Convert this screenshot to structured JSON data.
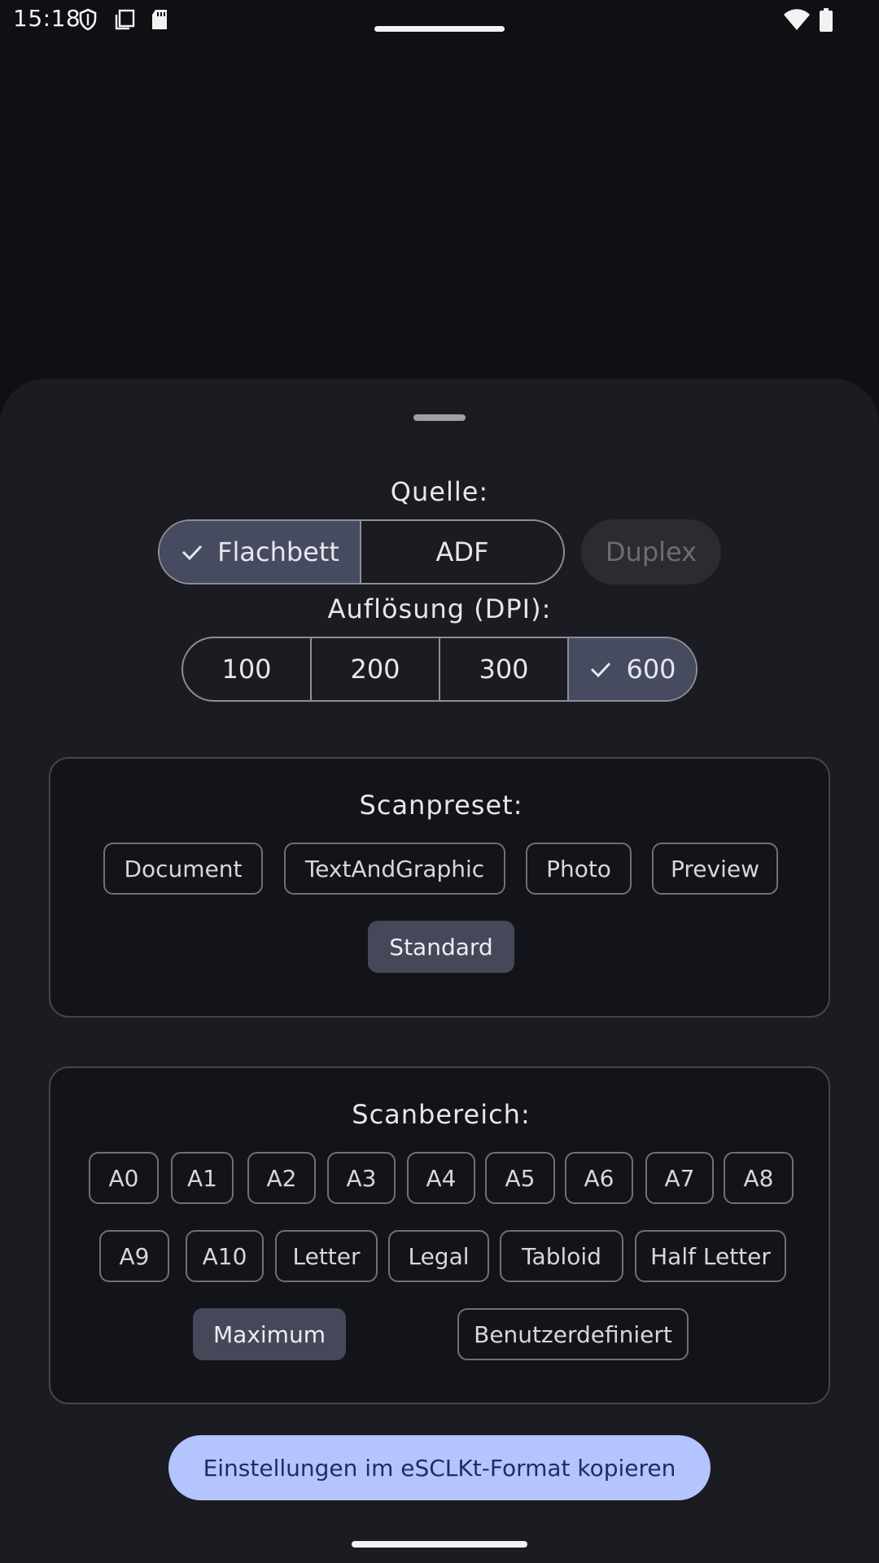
{
  "status_bar": {
    "time": "15:18"
  },
  "source": {
    "label": "Quelle:",
    "options": [
      {
        "label": "Flachbett",
        "selected": true
      },
      {
        "label": "ADF",
        "selected": false
      }
    ],
    "duplex_label": "Duplex"
  },
  "resolution": {
    "label": "Auflösung (DPI):",
    "options": [
      {
        "label": "100",
        "selected": false
      },
      {
        "label": "200",
        "selected": false
      },
      {
        "label": "300",
        "selected": false
      },
      {
        "label": "600",
        "selected": true
      }
    ]
  },
  "scanpreset": {
    "label": "Scanpreset:",
    "chips": [
      "Document",
      "TextAndGraphic",
      "Photo",
      "Preview",
      "Standard"
    ],
    "selected": "Standard"
  },
  "scanbereich": {
    "label": "Scanbereich:",
    "chips": [
      "A0",
      "A1",
      "A2",
      "A3",
      "A4",
      "A5",
      "A6",
      "A7",
      "A8",
      "A9",
      "A10",
      "Letter",
      "Legal",
      "Tabloid",
      "Half Letter",
      "Maximum",
      "Benutzerdefiniert"
    ],
    "selected": "Maximum"
  },
  "copy_button": {
    "label": "Einstellungen im eSCLKt-Format kopieren"
  },
  "colors": {
    "accent": "#b4c4ff",
    "selected": "#474b5f",
    "sheet": "#1b1c21"
  },
  "icons": [
    "shield-icon",
    "copy-icon",
    "sd-card-icon",
    "wifi-icon",
    "battery-icon",
    "check-icon"
  ]
}
